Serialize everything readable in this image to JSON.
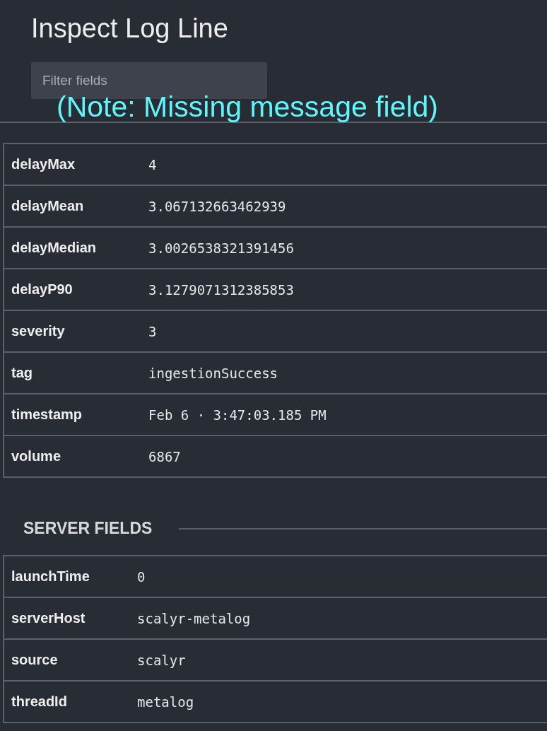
{
  "title": "Inspect Log Line",
  "filter": {
    "placeholder": "Filter fields"
  },
  "annotation": "(Note: Missing message field)",
  "fields": [
    {
      "key": "delayMax",
      "value": "4"
    },
    {
      "key": "delayMean",
      "value": "3.067132663462939"
    },
    {
      "key": "delayMedian",
      "value": "3.0026538321391456"
    },
    {
      "key": "delayP90",
      "value": "3.1279071312385853"
    },
    {
      "key": "severity",
      "value": "3"
    },
    {
      "key": "tag",
      "value": "ingestionSuccess"
    },
    {
      "key": "timestamp",
      "value": "Feb 6 · 3:47:03.185 PM"
    },
    {
      "key": "volume",
      "value": "6867"
    }
  ],
  "server_fields": {
    "heading": "SERVER FIELDS",
    "rows": [
      {
        "key": "launchTime",
        "value": "0"
      },
      {
        "key": "serverHost",
        "value": "scalyr-metalog"
      },
      {
        "key": "source",
        "value": "scalyr"
      },
      {
        "key": "threadId",
        "value": "metalog"
      }
    ]
  }
}
